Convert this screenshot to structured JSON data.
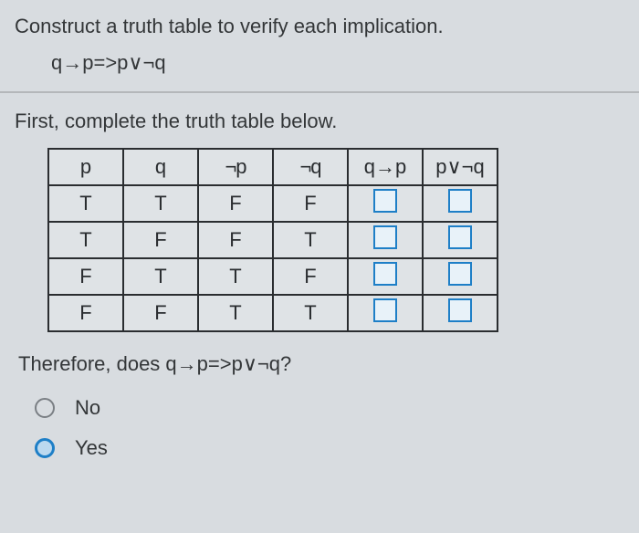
{
  "prompt": "Construct a truth table to verify each implication.",
  "expression": "q→p=>p∨¬q",
  "subprompt": "First, complete the truth table below.",
  "chart_data": {
    "type": "table",
    "title": "Truth table for q→p and p∨¬q",
    "headers": [
      "p",
      "q",
      "¬p",
      "¬q",
      "q→p",
      "p∨¬q"
    ],
    "rows": [
      {
        "p": "T",
        "q": "T",
        "not_p": "F",
        "not_q": "F",
        "q_imp_p": "",
        "p_or_notq": ""
      },
      {
        "p": "T",
        "q": "F",
        "not_p": "F",
        "not_q": "T",
        "q_imp_p": "",
        "p_or_notq": ""
      },
      {
        "p": "F",
        "q": "T",
        "not_p": "T",
        "not_q": "F",
        "q_imp_p": "",
        "p_or_notq": ""
      },
      {
        "p": "F",
        "q": "F",
        "not_p": "T",
        "not_q": "T",
        "q_imp_p": "",
        "p_or_notq": ""
      }
    ]
  },
  "therefore": "Therefore, does q→p=>p∨¬q?",
  "options": {
    "no": "No",
    "yes": "Yes"
  }
}
